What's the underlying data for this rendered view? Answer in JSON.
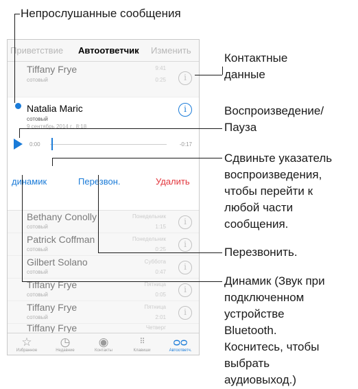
{
  "callouts": {
    "unheard": "Непрослушанные сообщения",
    "contact_1": "Контактные",
    "contact_2": "данные",
    "play_1": "Воспроизведение/",
    "play_2": "Пауза",
    "scrub_1": "Сдвиньте указатель",
    "scrub_2": "воспроизведения,",
    "scrub_3": "чтобы перейти к",
    "scrub_4": "любой части",
    "scrub_5": "сообщения.",
    "callback": "Перезвонить.",
    "speaker_1": "Динамик (Звук при",
    "speaker_2": "подключенном",
    "speaker_3": "устройстве",
    "speaker_4": "Bluetooth.",
    "speaker_5": "Коснитесь, чтобы",
    "speaker_6": "выбрать",
    "speaker_7": "аудиовыход.)"
  },
  "topbar": {
    "greeting": "Приветствие",
    "title": "Автоответчик",
    "edit": "Изменить"
  },
  "messages": [
    {
      "name": "Tiffany Frye",
      "type": "сотовый",
      "time": "9:41",
      "duration": "0:25"
    },
    {
      "name": "Bethany Conolly",
      "type": "сотовый",
      "time": "Понедельник",
      "duration": "1:15"
    },
    {
      "name": "Patrick Coffman",
      "type": "сотовый",
      "time": "Понедельник",
      "duration": "0:25"
    },
    {
      "name": "Gilbert Solano",
      "type": "сотовый",
      "time": "Суббота",
      "duration": "0:47"
    },
    {
      "name": "Tiffany Frye",
      "type": "сотовый",
      "time": "Пятница",
      "duration": "0:05"
    },
    {
      "name": "Tiffany Frye",
      "type": "сотовый",
      "time": "Пятница",
      "duration": "2:01"
    },
    {
      "name": "Tiffany Frye",
      "type": "сотовый",
      "time": "Четверг",
      "duration": ""
    }
  ],
  "selected": {
    "name": "Natalia Maric",
    "type": "сотовый",
    "date": "9 сентябрь 2014 г., 8:18",
    "time_start": "0:00",
    "time_remaining": "-0:17",
    "speaker": "динамик",
    "callback": "Перезвон.",
    "delete": "Удалить"
  },
  "tabs": [
    {
      "label": "Избранное",
      "icon": "star-icon"
    },
    {
      "label": "Недавние",
      "icon": "clock-icon"
    },
    {
      "label": "Контакты",
      "icon": "person-icon"
    },
    {
      "label": "Клавиши",
      "icon": "keypad-icon"
    },
    {
      "label": "Автоответч.",
      "icon": "voicemail-icon"
    }
  ],
  "colors": {
    "accent": "#1a7bd8",
    "delete": "#e2353c"
  }
}
